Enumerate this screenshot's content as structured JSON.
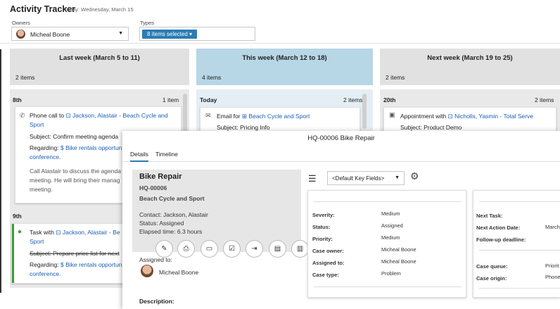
{
  "header": {
    "title": "Activity Tracker",
    "date": "Today: Wednesday, March 15"
  },
  "filters": {
    "owners_label": "Owners",
    "owner_value": "Micheal Boone",
    "types_label": "Types",
    "types_value": "8 items selected"
  },
  "columns": [
    {
      "title": "Last week (March 5 to 11)",
      "count": "2 items"
    },
    {
      "title": "This week (March 12 to 18)",
      "count": "4 items"
    },
    {
      "title": "Next week (March 19 to 25)",
      "count": "2 items"
    }
  ],
  "groups": {
    "last_8th": {
      "label": "8th",
      "count": "1 item"
    },
    "last_9th": {
      "label": "9th"
    },
    "this_today": {
      "label": "Today",
      "count": "2 items"
    },
    "next_20th": {
      "label": "20th",
      "count": "2 items"
    }
  },
  "cards": {
    "phone": {
      "prefix": "Phone call to",
      "link": "Jackson, Alastair - Beach Cycle and",
      "link2": "Sport",
      "subject": "Subject: Confirm meeting agenda",
      "regarding_label": "Regarding:",
      "regarding_link": "Bike rentals opportun",
      "regarding_link2": "conference.",
      "body1": "Call Alastair to discuss the agenda",
      "body2": "meeting. He will bring their manag",
      "body3": "meeting."
    },
    "task": {
      "prefix": "Task with",
      "link": "Jackson, Alastair - Be",
      "link2": "Sport",
      "subject": "Subject: Prepare price list for next",
      "regarding_label": "Regarding:",
      "regarding_link": "Bike rentals opportun",
      "regarding_link2": "conference."
    },
    "email": {
      "prefix": "Email for",
      "link": "Beach Cycle and Sport",
      "subject": "Subject: Pricing Info"
    },
    "appointment": {
      "prefix": "Appointment with",
      "link": "Nicholls, Yasmin - Total Serve",
      "subject": "Subject: Product Demo"
    }
  },
  "panel": {
    "title": "HQ-00006 Bike Repair",
    "tabs": [
      "Details",
      "Timeline"
    ],
    "summary": {
      "name": "Bike Repair",
      "id": "HQ-00006",
      "account": "Beach Cycle and Sport",
      "contact": "Contact: Jackson, Alastair",
      "status": "Status: Assigned",
      "elapsed": "Elapsed time: 6.3 hours",
      "assigned_label": "Assigned to:",
      "assigned_name": "Micheal Boone",
      "description_label": "Description:"
    },
    "key_fields_select": "<Default Key Fields>",
    "fields": [
      {
        "label": "Severity:",
        "value": "Medium"
      },
      {
        "label": "Status:",
        "value": "Assigned"
      },
      {
        "label": "Priority:",
        "value": "Medium"
      },
      {
        "label": "Case owner:",
        "value": "Micheal Boone"
      },
      {
        "label": "Assigned to:",
        "value": "Micheal Boone"
      },
      {
        "label": "Case type:",
        "value": "Problem"
      }
    ],
    "fields2": [
      {
        "label": "Next Task:",
        "value": ""
      },
      {
        "label": "Next Action Date:",
        "value": "March"
      },
      {
        "label": "Follow-up deadline:",
        "value": ""
      },
      {
        "label": "Case queue:",
        "value": "Priorit"
      },
      {
        "label": "Case origin:",
        "value": "Phone"
      }
    ]
  }
}
